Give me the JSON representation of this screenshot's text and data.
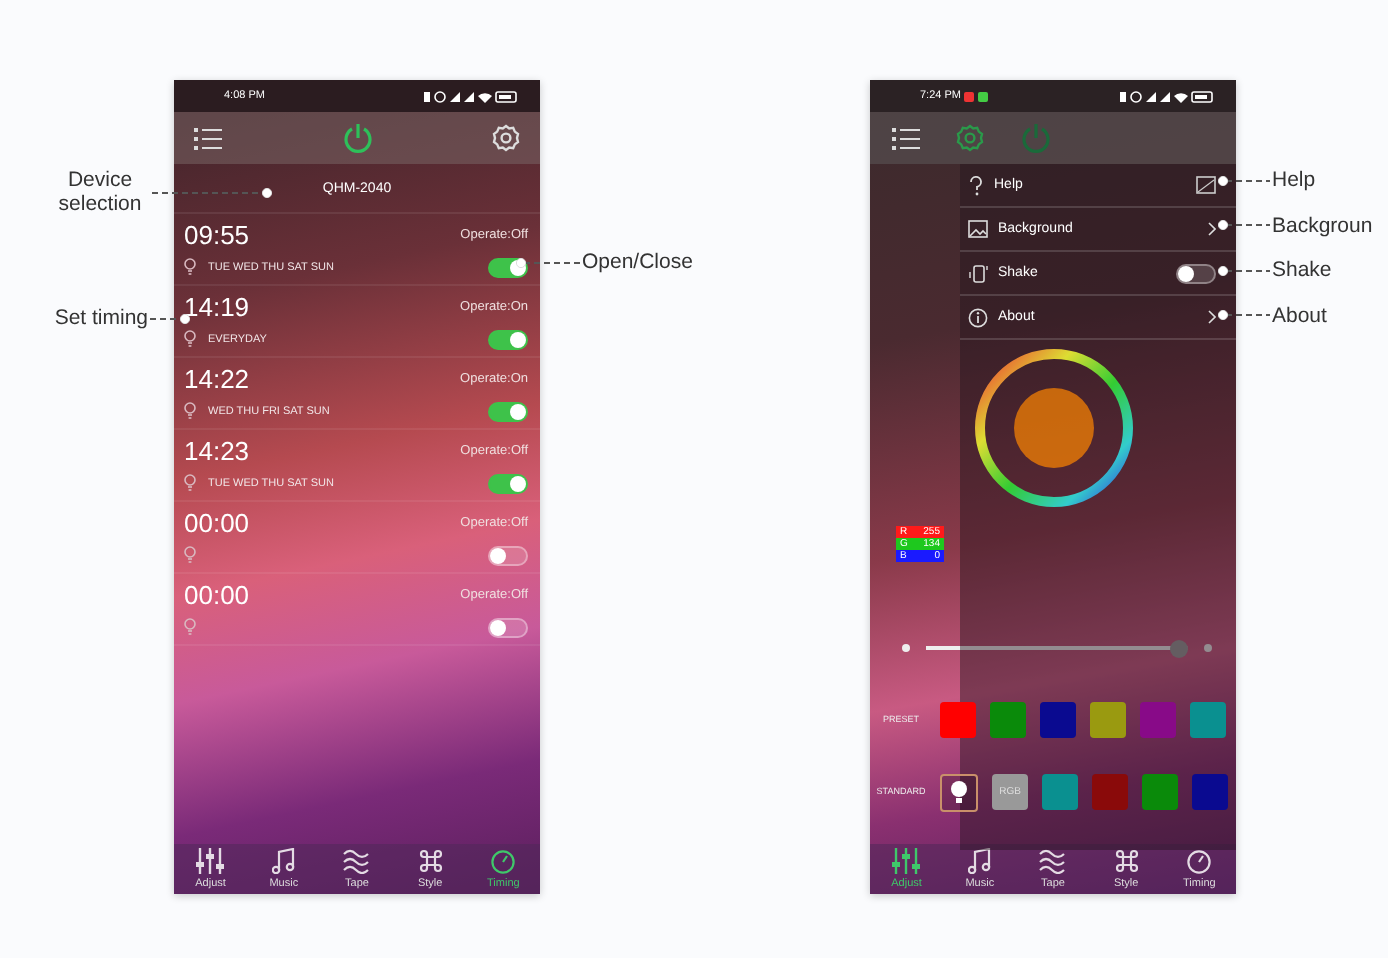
{
  "timer_screen": {
    "status_bar": {
      "time": "4:08 PM"
    },
    "device": "QHM-2040",
    "timers": [
      {
        "time": "09:55",
        "operate": "Operate:Off",
        "days": "TUE WED THU SAT SUN",
        "on": true
      },
      {
        "time": "14:19",
        "operate": "Operate:On",
        "days": "EVERYDAY",
        "on": true
      },
      {
        "time": "14:22",
        "operate": "Operate:On",
        "days": "WED THU FRI SAT SUN",
        "on": true
      },
      {
        "time": "14:23",
        "operate": "Operate:Off",
        "days": "TUE WED THU SAT SUN",
        "on": true
      },
      {
        "time": "00:00",
        "operate": "Operate:Off",
        "on": false
      },
      {
        "time": "00:00",
        "operate": "Operate:Off",
        "on": false
      }
    ],
    "tabs": [
      {
        "label": "Adjust",
        "selected": false
      },
      {
        "label": "Music",
        "selected": false
      },
      {
        "label": "Tape",
        "selected": false
      },
      {
        "label": "Style",
        "selected": false
      },
      {
        "label": "Timing",
        "selected": true
      }
    ]
  },
  "timer_annotations": [
    "Device selection",
    "Set timing",
    "Open/Close"
  ],
  "color_screen": {
    "status_bar": {
      "time": "7:24 PM"
    },
    "menu": [
      {
        "kind": "image",
        "label": "Help"
      },
      {
        "kind": "link",
        "label": "Background"
      },
      {
        "kind": "toggle",
        "label": "Shake",
        "on": false
      },
      {
        "kind": "link",
        "label": "About"
      }
    ],
    "rgb": [
      {
        "channel": "R",
        "value": "255",
        "color": "#ff1a1a"
      },
      {
        "channel": "G",
        "value": "134",
        "color": "#1ec81e"
      },
      {
        "channel": "B",
        "value": "0",
        "color": "#1a1aff"
      }
    ],
    "brightness": {
      "level": 0.97
    },
    "preset": {
      "label": "PRESET",
      "colors": [
        {
          "color": "#ff0000"
        },
        {
          "color": "#0a8a0a"
        },
        {
          "color": "#0a0a90"
        },
        {
          "color": "#9a9a10"
        },
        {
          "color": "#880a88"
        },
        {
          "color": "#0a9090"
        }
      ]
    },
    "standard": {
      "label": "STANDARD",
      "button": "RGB",
      "colors": [
        {
          "color": "#0a9090"
        },
        {
          "color": "#8a0a0a"
        },
        {
          "color": "#0a8a0a"
        },
        {
          "color": "#0a0a90"
        }
      ]
    },
    "tabs": [
      {
        "label": "Adjust",
        "selected": true
      },
      {
        "label": "Music",
        "selected": false
      },
      {
        "label": "Tape",
        "selected": false
      },
      {
        "label": "Style",
        "selected": false
      },
      {
        "label": "Timing",
        "selected": false
      }
    ]
  },
  "menu_annotations": [
    "Help",
    "Backgroun",
    "Shake",
    "About"
  ]
}
